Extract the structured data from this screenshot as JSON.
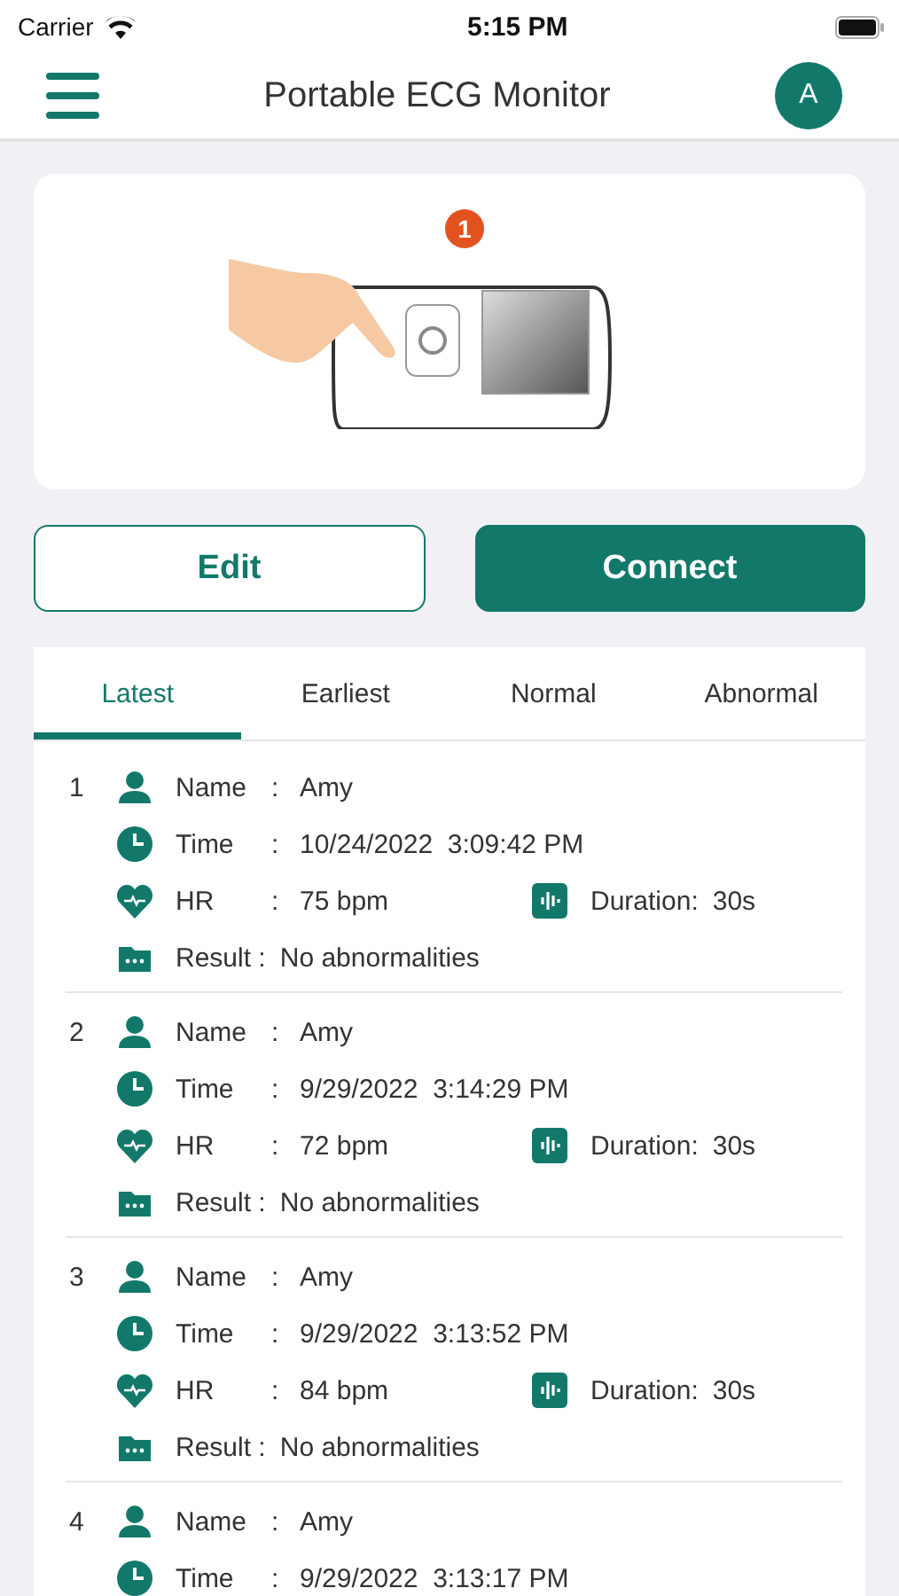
{
  "status_bar": {
    "carrier": "Carrier",
    "time": "5:15 PM"
  },
  "header": {
    "title": "Portable ECG Monitor",
    "avatar": "A"
  },
  "illustration": {
    "step_badge": "1"
  },
  "buttons": [
    {
      "label": "Edit",
      "kind": "outline"
    },
    {
      "label": "Connect",
      "kind": "filled"
    }
  ],
  "tabs": [
    {
      "label": "Latest",
      "selected": true
    },
    {
      "label": "Earliest",
      "selected": false
    },
    {
      "label": "Normal",
      "selected": false
    },
    {
      "label": "Abnormal",
      "selected": false
    }
  ],
  "records": [
    {
      "index": "1",
      "fields": [
        {
          "kind": "name",
          "label": "Name",
          "sep": ":",
          "value": "Amy"
        },
        {
          "kind": "time",
          "label": "Time",
          "sep": ":",
          "value": "10/24/2022  3:09:42 PM"
        },
        {
          "kind": "hr",
          "label": "HR",
          "sep": ":",
          "value": "75 bpm",
          "extra_label": "Duration:",
          "extra_value": "30s"
        },
        {
          "kind": "result",
          "label": "Result :",
          "value": "No abnormalities"
        }
      ]
    },
    {
      "index": "2",
      "fields": [
        {
          "kind": "name",
          "label": "Name",
          "sep": ":",
          "value": "Amy"
        },
        {
          "kind": "time",
          "label": "Time",
          "sep": ":",
          "value": "9/29/2022  3:14:29 PM"
        },
        {
          "kind": "hr",
          "label": "HR",
          "sep": ":",
          "value": "72 bpm",
          "extra_label": "Duration:",
          "extra_value": "30s"
        },
        {
          "kind": "result",
          "label": "Result :",
          "value": "No abnormalities"
        }
      ]
    },
    {
      "index": "3",
      "fields": [
        {
          "kind": "name",
          "label": "Name",
          "sep": ":",
          "value": "Amy"
        },
        {
          "kind": "time",
          "label": "Time",
          "sep": ":",
          "value": "9/29/2022  3:13:52 PM"
        },
        {
          "kind": "hr",
          "label": "HR",
          "sep": ":",
          "value": "84 bpm",
          "extra_label": "Duration:",
          "extra_value": "30s"
        },
        {
          "kind": "result",
          "label": "Result :",
          "value": "No abnormalities"
        }
      ]
    },
    {
      "index": "4",
      "fields": [
        {
          "kind": "name",
          "label": "Name",
          "sep": ":",
          "value": "Amy"
        },
        {
          "kind": "time",
          "label": "Time",
          "sep": ":",
          "value": "9/29/2022  3:13:17 PM"
        }
      ]
    }
  ]
}
